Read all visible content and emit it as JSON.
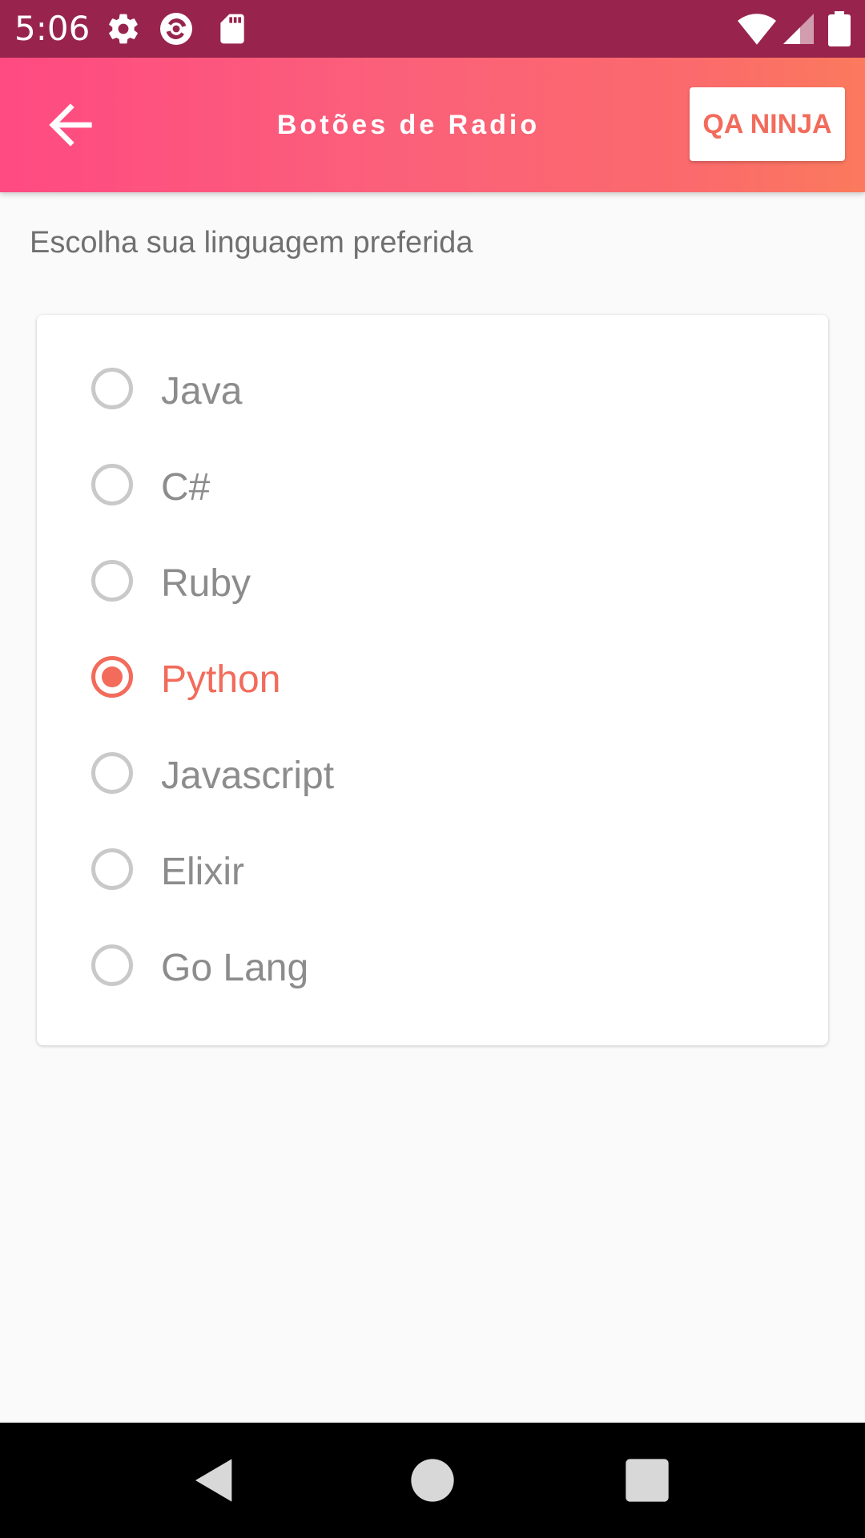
{
  "status_bar": {
    "time": "5:06",
    "icons": [
      "gear-icon",
      "sync-icon",
      "sd-card-icon",
      "wifi-icon",
      "signal-icon",
      "battery-icon"
    ]
  },
  "app_bar": {
    "title": "Botões de Radio",
    "back_icon": "arrow-left-icon",
    "action_label": "QA NINJA"
  },
  "main": {
    "prompt": "Escolha sua linguagem preferida",
    "options": [
      {
        "label": "Java",
        "checked": false
      },
      {
        "label": "C#",
        "checked": false
      },
      {
        "label": "Ruby",
        "checked": false
      },
      {
        "label": "Python",
        "checked": true
      },
      {
        "label": "Javascript",
        "checked": false
      },
      {
        "label": "Elixir",
        "checked": false
      },
      {
        "label": "Go Lang",
        "checked": false
      }
    ]
  },
  "nav_bar": {
    "icons": [
      "back-triangle-icon",
      "home-circle-icon",
      "recents-square-icon"
    ]
  },
  "colors": {
    "status_bar": "#98244d",
    "app_bar_start": "#ff4a82",
    "app_bar_end": "#fb7a5d",
    "accent": "#f26b5b",
    "radio_unchecked": "#c9c9c9",
    "label_text": "#8c8c8c",
    "background": "#fafafa"
  }
}
